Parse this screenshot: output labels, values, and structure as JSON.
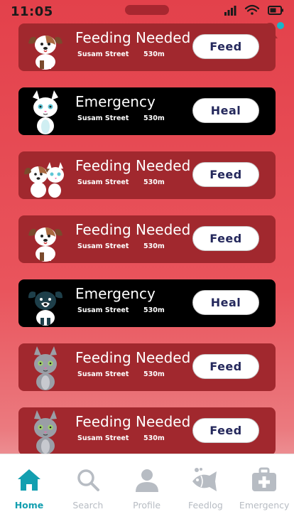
{
  "status_bar": {
    "time": "11:05"
  },
  "colors": {
    "accent": "#139fb0",
    "card_feeding": "#a1282e",
    "card_emergency": "#000000",
    "button_text": "#24285c",
    "inactive": "#b7bcc3"
  },
  "cards": [
    {
      "title": "Feeding Needed",
      "street": "Susam Street",
      "distance": "530m",
      "button": "Feed",
      "pet": "dog-icon",
      "kind": "feeding"
    },
    {
      "title": "Emergency",
      "street": "Susam Street",
      "distance": "530m",
      "button": "Heal",
      "pet": "cat-icon",
      "kind": "emergency"
    },
    {
      "title": "Feeding Needed",
      "street": "Susam Street",
      "distance": "530m",
      "button": "Feed",
      "pet": "dog-and-cat-icon",
      "kind": "feeding"
    },
    {
      "title": "Feeding Needed",
      "street": "Susam Street",
      "distance": "530m",
      "button": "Feed",
      "pet": "dog-icon",
      "kind": "feeding"
    },
    {
      "title": "Emergency",
      "street": "Susam Street",
      "distance": "530m",
      "button": "Heal",
      "pet": "dark-dog-icon",
      "kind": "emergency"
    },
    {
      "title": "Feeding Needed",
      "street": "Susam Street",
      "distance": "530m",
      "button": "Feed",
      "pet": "gray-cat-icon",
      "kind": "feeding"
    },
    {
      "title": "Feeding Needed",
      "street": "Susam Street",
      "distance": "530m",
      "button": "Feed",
      "pet": "gray-cat-icon",
      "kind": "feeding"
    }
  ],
  "nav": [
    {
      "label": "Home",
      "icon": "home-icon",
      "active": true
    },
    {
      "label": "Search",
      "icon": "search-icon",
      "active": false
    },
    {
      "label": "Profile",
      "icon": "profile-icon",
      "active": false
    },
    {
      "label": "Feedlog",
      "icon": "fish-icon",
      "active": false
    },
    {
      "label": "Emergency",
      "icon": "first-aid-kit-icon",
      "active": false
    }
  ]
}
